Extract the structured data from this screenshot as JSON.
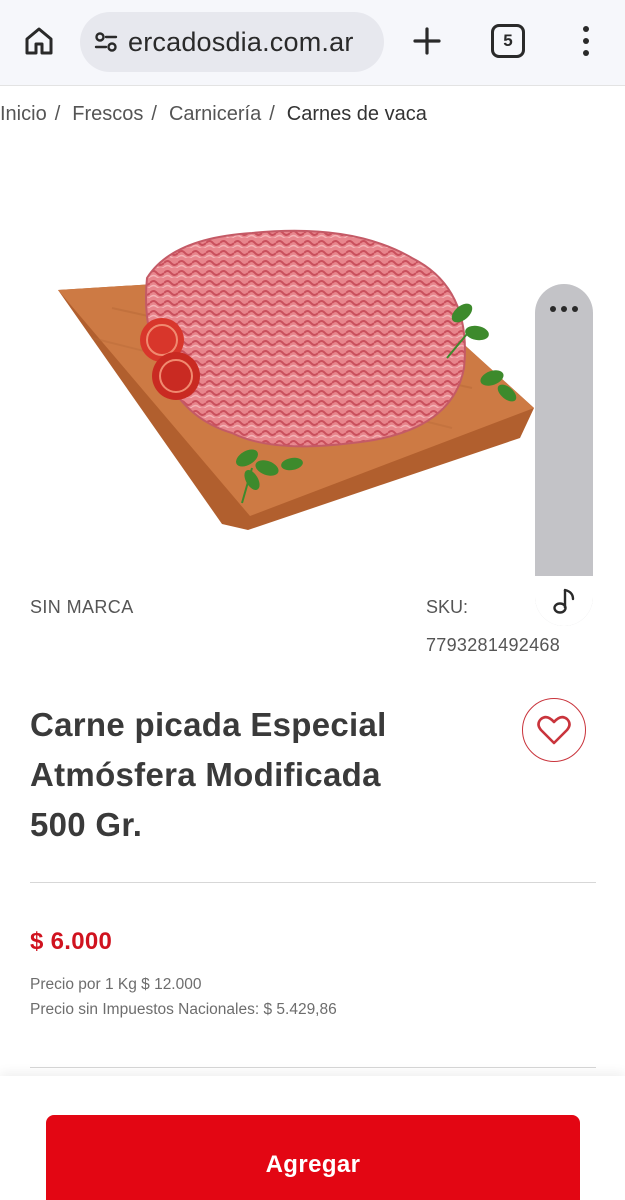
{
  "browser": {
    "url": "ercadosdia.com.ar",
    "tab_count": "5",
    "icons": [
      "home-icon",
      "site-settings-icon",
      "plus-icon",
      "tabs-icon",
      "more-vert-icon"
    ]
  },
  "breadcrumb": [
    {
      "label": "Inicio"
    },
    {
      "label": "Frescos"
    },
    {
      "label": "Carnicería"
    },
    {
      "label": "Carnes de vaca"
    }
  ],
  "product": {
    "brand": "SIN MARCA",
    "sku_label": "SKU:",
    "sku_value": "7793281492468",
    "title_lines": [
      "Carne picada Especial",
      "Atmósfera Modificada",
      "500 Gr."
    ],
    "price": "$ 6.000",
    "price_per_kg": "Precio por 1 Kg $ 12.000",
    "price_without_taxes": "Precio sin Impuestos Nacionales: $ 5.429,86",
    "image_icon": "ground-beef-on-cutting-board"
  },
  "side_panel": {
    "icons": [
      "more-horiz-icon",
      "music-note-icon"
    ]
  },
  "actions": {
    "add_label": "Agregar"
  },
  "colors": {
    "accent": "#e30613",
    "price": "#d0131f",
    "favorite": "#c9343c"
  }
}
